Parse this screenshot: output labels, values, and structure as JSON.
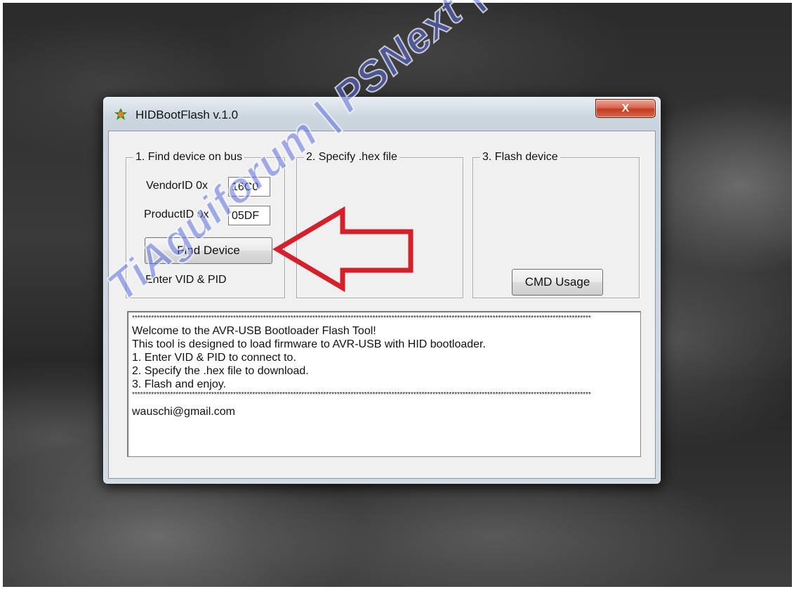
{
  "window": {
    "title": "HIDBootFlash v.1.0",
    "close_glyph": "X"
  },
  "group_find": {
    "legend": "1. Find device on bus",
    "vendor_label": "VendorID 0x",
    "vendor_value": "16C0",
    "product_label": "ProductID 0x",
    "product_value": "05DF",
    "find_button": "Find Device",
    "status": "Enter VID & PID"
  },
  "group_hex": {
    "legend": "2. Specify .hex file"
  },
  "group_flash": {
    "legend": "3. Flash device",
    "cmd_button": "CMD Usage"
  },
  "console": {
    "stars": "************************************************************************************************************************************************************************",
    "lines": [
      "Welcome to the AVR-USB Bootloader Flash Tool!",
      "This tool is designed to load firmware to AVR-USB with HID bootloader.",
      "1. Enter VID & PID to connect to.",
      "2. Specify the .hex file to download.",
      "3. Flash and enjoy."
    ],
    "email": "wauschi@gmail.com"
  },
  "watermark": "TiAguiforum | PSNext | Team",
  "colors": {
    "arrow": "#d4202a",
    "close_button": "#c4391e",
    "watermark": "#5a6edc"
  },
  "icons": [
    "app-icon",
    "close-icon",
    "arrow-annotation"
  ]
}
